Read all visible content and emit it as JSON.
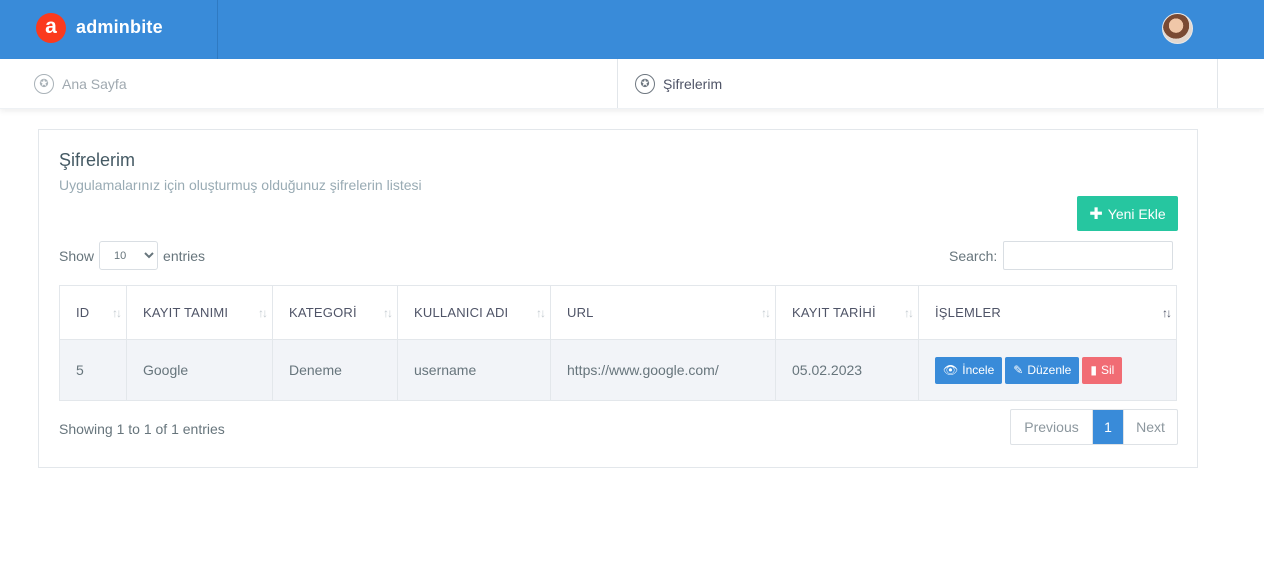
{
  "brand": {
    "logo_letter": "a",
    "name": "adminbite",
    "logo_color": "#fb3a1e"
  },
  "topbar": {
    "color": "#398bd9"
  },
  "tabs": [
    {
      "label": "Ana Sayfa"
    },
    {
      "label": "Şifrelerim"
    }
  ],
  "card": {
    "title": "Şifrelerim",
    "subtitle": "Uygulamalarınız için oluşturmuş olduğunuz şifrelerin listesi",
    "add_button": "Yeni Ekle",
    "show_label": "Show",
    "entries_label": "entries",
    "page_size": "10",
    "search_label": "Search:"
  },
  "table": {
    "headers": [
      "ID",
      "KAYIT TANIMI",
      "KATEGORİ",
      "KULLANICI ADI",
      "URL",
      "KAYIT TARİHİ",
      "İŞLEMLER"
    ],
    "rows": [
      {
        "id": "5",
        "name": "Google",
        "category": "Deneme",
        "username": "username",
        "url": "https://www.google.com/",
        "date": "05.02.2023"
      }
    ],
    "actions": {
      "view": "İncele",
      "edit": "Düzenle",
      "delete": "Sil"
    }
  },
  "footer": {
    "info": "Showing 1 to 1 of 1 entries",
    "previous": "Previous",
    "page": "1",
    "next": "Next"
  }
}
